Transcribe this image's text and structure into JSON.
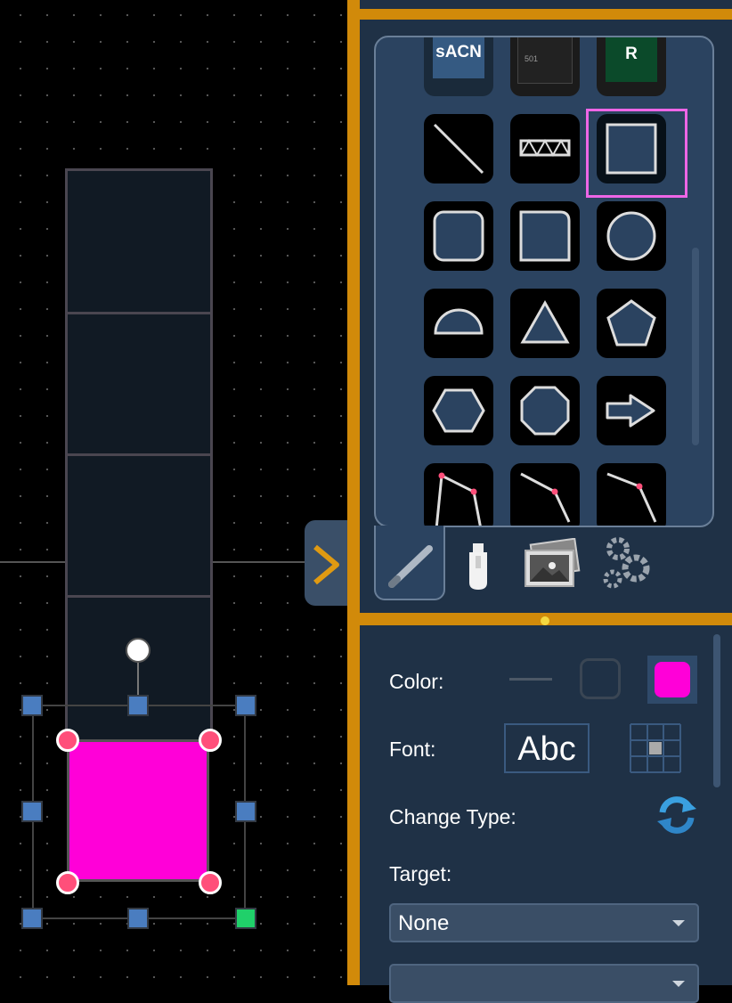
{
  "palette": {
    "tiles": [
      {
        "name": "sacn-tile",
        "label": "sACN"
      },
      {
        "name": "device-tile",
        "label": "501"
      },
      {
        "name": "r-tile",
        "label": "R"
      },
      {
        "name": "line-tile",
        "icon": "line-icon"
      },
      {
        "name": "truss-tile",
        "icon": "truss-icon"
      },
      {
        "name": "rectangle-tile",
        "icon": "rectangle-icon",
        "selected": true
      },
      {
        "name": "rounded-rect-tile",
        "icon": "rounded-rect-icon"
      },
      {
        "name": "rounded-corner-rect-tile",
        "icon": "rounded-corner-rect-icon"
      },
      {
        "name": "circle-tile",
        "icon": "circle-icon"
      },
      {
        "name": "semicircle-tile",
        "icon": "semicircle-icon"
      },
      {
        "name": "triangle-tile",
        "icon": "triangle-icon"
      },
      {
        "name": "pentagon-tile",
        "icon": "pentagon-icon"
      },
      {
        "name": "hexagon-tile",
        "icon": "hexagon-icon"
      },
      {
        "name": "octagon-tile",
        "icon": "octagon-icon"
      },
      {
        "name": "arrow-tile",
        "icon": "arrow-right-icon"
      },
      {
        "name": "polyline-tile-1",
        "icon": "polyline-icon"
      },
      {
        "name": "polyline-tile-2",
        "icon": "polyline-icon"
      },
      {
        "name": "polyline-tile-3",
        "icon": "polyline-icon"
      }
    ],
    "tabs": [
      {
        "name": "tab-draw",
        "icon": "pencil-icon"
      },
      {
        "name": "tab-fixtures",
        "icon": "fixture-icon"
      },
      {
        "name": "tab-images",
        "icon": "images-icon"
      },
      {
        "name": "tab-settings",
        "icon": "gears-icon"
      }
    ]
  },
  "properties": {
    "color_label": "Color:",
    "font_label": "Font:",
    "font_sample": "Abc",
    "change_type_label": "Change Type:",
    "target_label": "Target:",
    "target_value": "None",
    "fill_color": "#ff00d8"
  },
  "colors": {
    "accent_orange": "#d18a0a",
    "panel_bg": "#1f3146",
    "selection_highlight": "#ee66e6"
  }
}
